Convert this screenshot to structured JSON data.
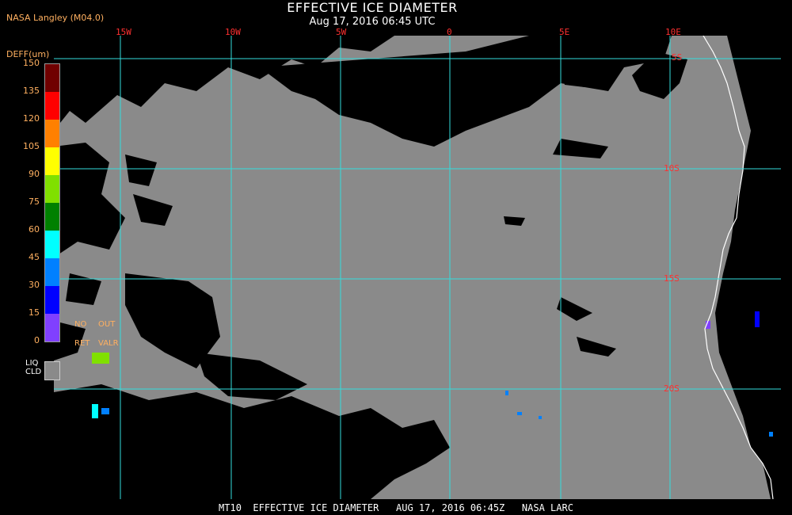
{
  "header": {
    "producer": "NASA Langley (M04.0)",
    "title": "EFFECTIVE ICE DIAMETER",
    "subtitle": "Aug 17, 2016 06:45 UTC"
  },
  "map": {
    "longitude_labels": [
      "15W",
      "10W",
      "5W",
      "0",
      "5E",
      "10E"
    ],
    "latitude_labels": [
      "5S",
      "10S",
      "15S",
      "20S"
    ],
    "colors": {
      "background": "#8a8a8a",
      "clear": "#000000",
      "grid": "#33dddd",
      "coastline": "#ffffff",
      "grid_label": "#ff3030"
    }
  },
  "legend": {
    "title": "DEFF(um)",
    "ticks": [
      "150",
      "135",
      "120",
      "105",
      "90",
      "75",
      "60",
      "45",
      "30",
      "15",
      "0"
    ],
    "colors": [
      "#700000",
      "#ff0000",
      "#ff8000",
      "#ffff00",
      "#80e000",
      "#008000",
      "#00ffff",
      "#0080ff",
      "#0000ff",
      "#8040ff"
    ],
    "no_retrieval": [
      "NO",
      "RET"
    ],
    "out_of_range": [
      "OUT",
      "VALR"
    ],
    "liquid_cloud": [
      "LIQ",
      "CLD"
    ]
  },
  "footer": {
    "text": "MT10  EFFECTIVE ICE DIAMETER   AUG 17, 2016 06:45Z   NASA LARC"
  }
}
